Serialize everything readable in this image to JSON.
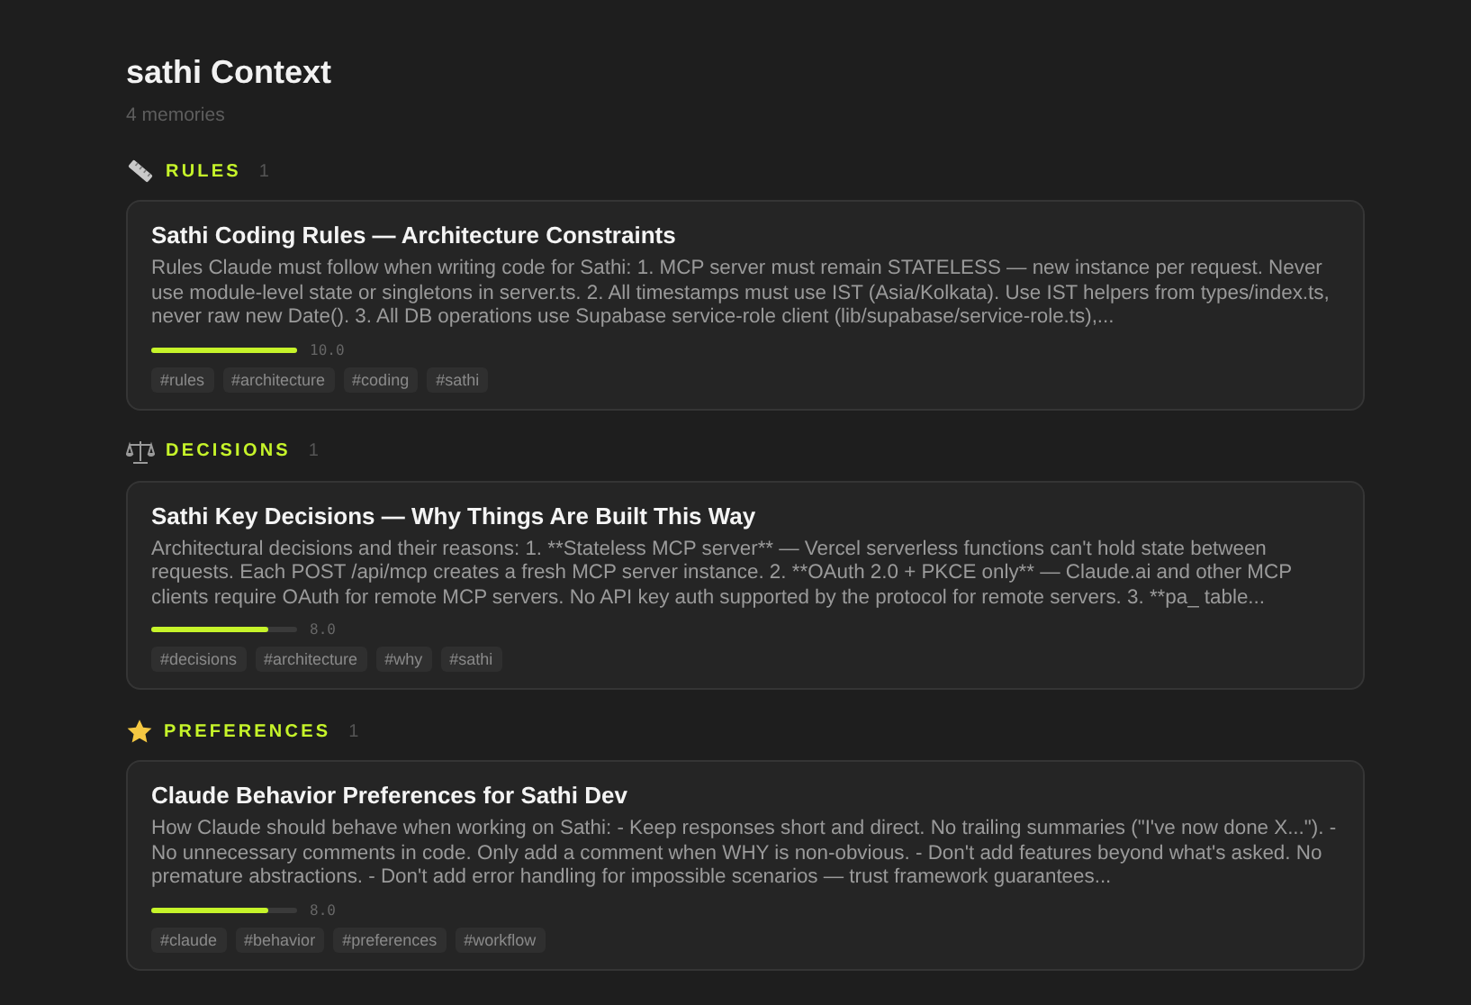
{
  "header": {
    "title": "sathi Context",
    "subtitle": "4 memories"
  },
  "sections": [
    {
      "kind": "ruler",
      "label": "RULES",
      "count": "1",
      "cards": [
        {
          "title": "Sathi Coding Rules — Architecture Constraints",
          "body": "Rules Claude must follow when writing code for Sathi: 1. MCP server must remain STATELESS — new instance per request. Never use module-level state or singletons in server.ts. 2. All timestamps must use IST (Asia/Kolkata). Use IST helpers from types/index.ts, never raw new Date(). 3. All DB operations use Supabase service-role client (lib/supabase/service-role.ts),...",
          "level": 1.0,
          "score": "10.0",
          "tags": [
            "#rules",
            "#architecture",
            "#coding",
            "#sathi"
          ]
        }
      ]
    },
    {
      "kind": "scales",
      "label": "DECISIONS",
      "count": "1",
      "cards": [
        {
          "title": "Sathi Key Decisions — Why Things Are Built This Way",
          "body": "Architectural decisions and their reasons: 1. **Stateless MCP server** — Vercel serverless functions can't hold state between requests. Each POST /api/mcp creates a fresh MCP server instance. 2. **OAuth 2.0 + PKCE only** — Claude.ai and other MCP clients require OAuth for remote MCP servers. No API key auth supported by the protocol for remote servers. 3. **pa_ table...",
          "level": 0.8,
          "score": "8.0",
          "tags": [
            "#decisions",
            "#architecture",
            "#why",
            "#sathi"
          ]
        }
      ]
    },
    {
      "kind": "star",
      "label": "PREFERENCES",
      "count": "1",
      "cards": [
        {
          "title": "Claude Behavior Preferences for Sathi Dev",
          "body": "How Claude should behave when working on Sathi: - Keep responses short and direct. No trailing summaries (\"I've now done X...\"). - No unnecessary comments in code. Only add a comment when WHY is non-obvious. - Don't add features beyond what's asked. No premature abstractions. - Don't add error handling for impossible scenarios — trust framework guarantees...",
          "level": 0.8,
          "score": "8.0",
          "tags": [
            "#claude",
            "#behavior",
            "#preferences",
            "#workflow"
          ]
        }
      ]
    }
  ]
}
